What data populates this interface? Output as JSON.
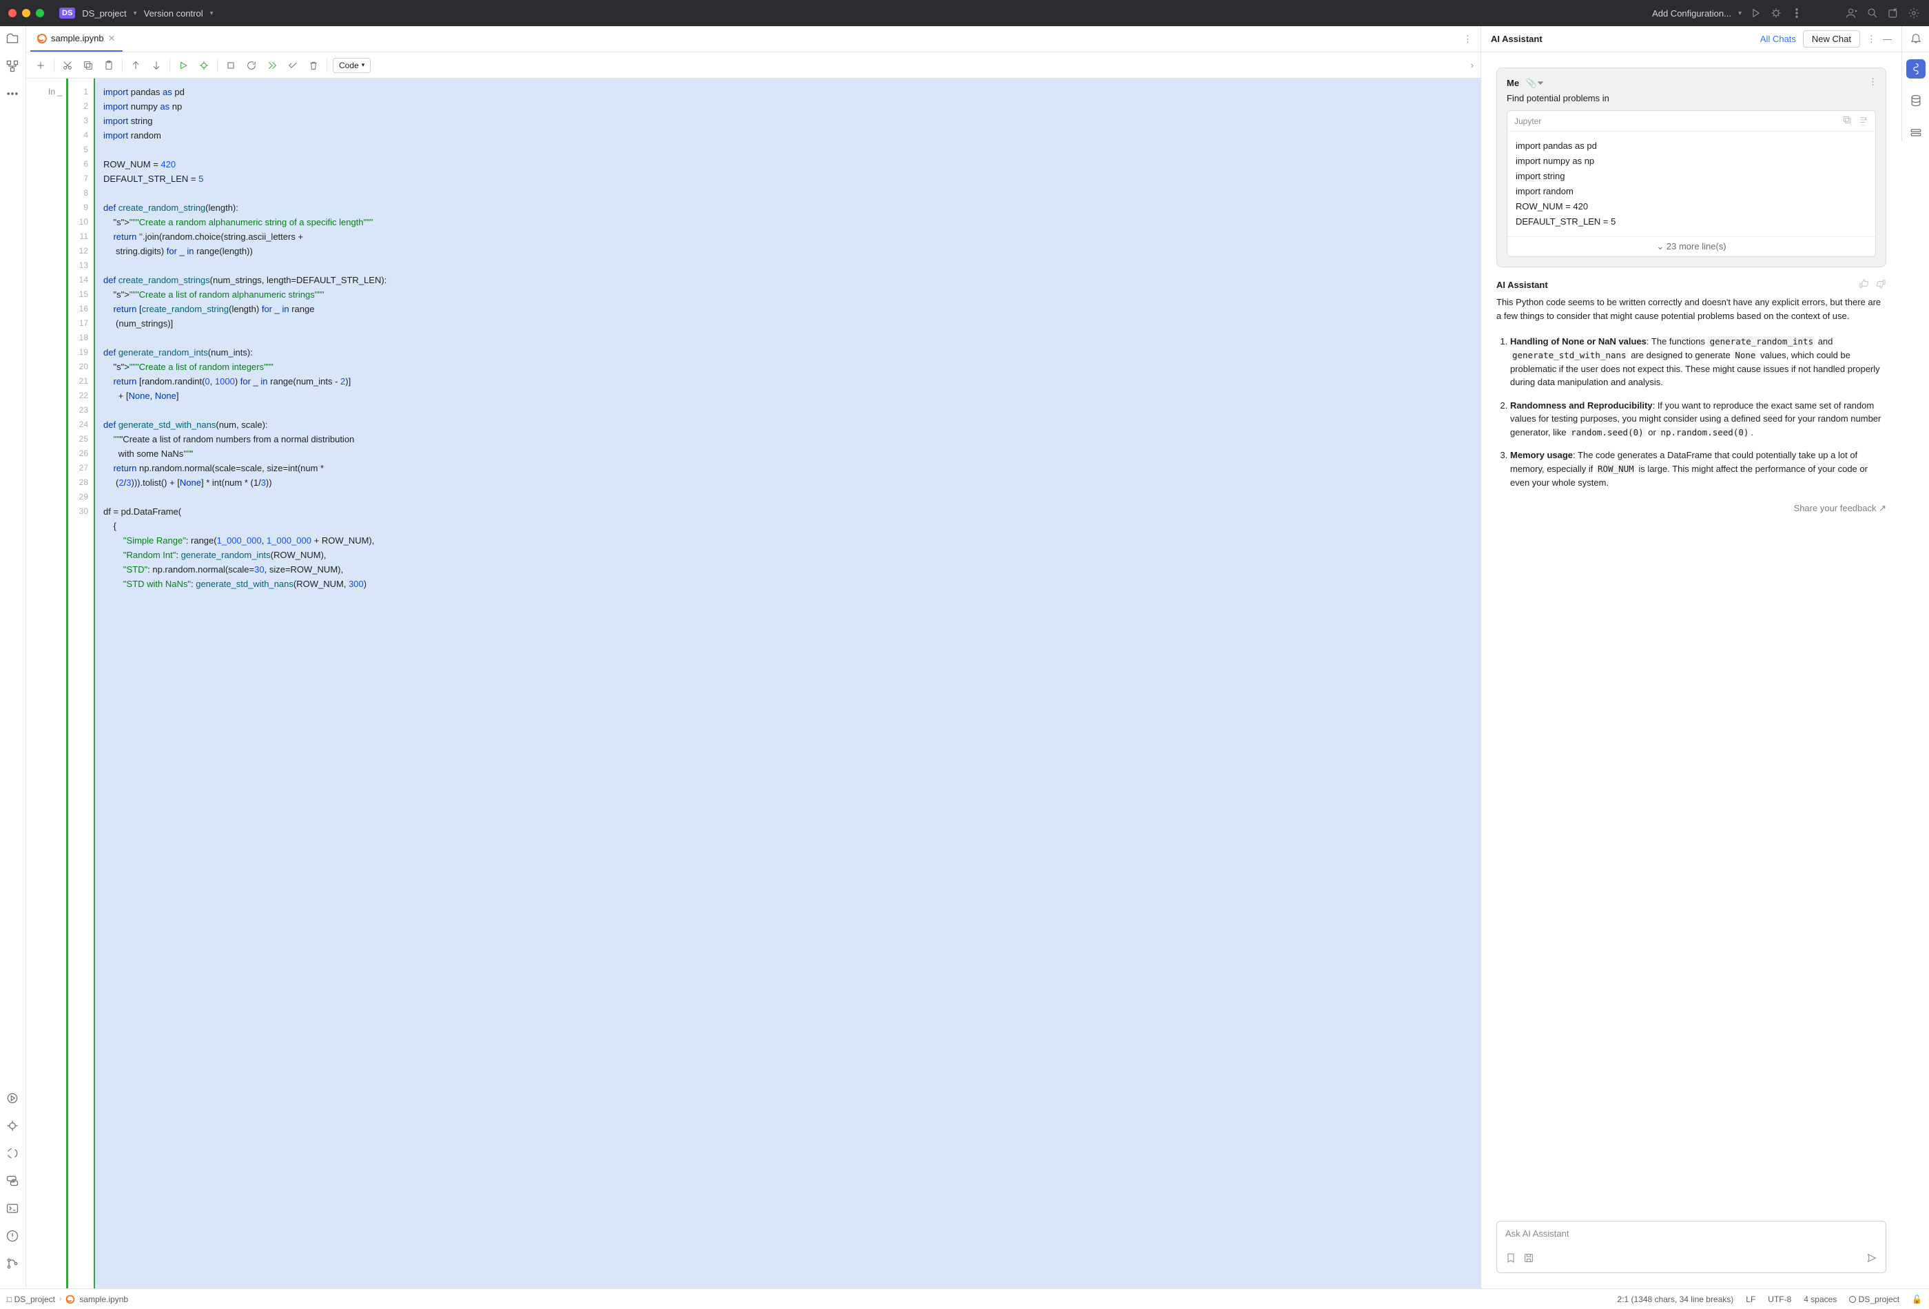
{
  "titlebar": {
    "project_badge": "DS",
    "project_name": "DS_project",
    "vcs": "Version control",
    "run_config": "Add Configuration..."
  },
  "tab": {
    "filename": "sample.ipynb"
  },
  "toolbar": {
    "cell_type": "Code"
  },
  "editor": {
    "in_label": "In _",
    "line_count": 30,
    "code": "import pandas as pd\nimport numpy as np\nimport string\nimport random\n\nROW_NUM = 420\nDEFAULT_STR_LEN = 5\n\ndef create_random_string(length):\n    \"\"\"Create a random alphanumeric string of a specific length\"\"\"\n    return ''.join(random.choice(string.ascii_letters +\n     string.digits) for _ in range(length))\n\ndef create_random_strings(num_strings, length=DEFAULT_STR_LEN):\n    \"\"\"Create a list of random alphanumeric strings\"\"\"\n    return [create_random_string(length) for _ in range\n     (num_strings)]\n\ndef generate_random_ints(num_ints):\n    \"\"\"Create a list of random integers\"\"\"\n    return [random.randint(0, 1000) for _ in range(num_ints - 2)]\n      + [None, None]\n\ndef generate_std_with_nans(num, scale):\n    \"\"\"Create a list of random numbers from a normal distribution\n      with some NaNs\"\"\"\n    return np.random.normal(scale=scale, size=int(num *\n     (2/3))).tolist() + [None] * int(num * (1/3))\n\ndf = pd.DataFrame(\n    {\n        \"Simple Range\": range(1_000_000, 1_000_000 + ROW_NUM),\n        \"Random Int\": generate_random_ints(ROW_NUM),\n        \"STD\": np.random.normal(scale=30, size=ROW_NUM),\n        \"STD with NaNs\": generate_std_with_nans(ROW_NUM, 300)"
  },
  "ai": {
    "header_title": "AI Assistant",
    "all_chats": "All Chats",
    "new_chat": "New Chat",
    "me_label": "Me",
    "me_msg": "Find potential problems in",
    "code_lang": "Jupyter",
    "code_snippet": "import pandas as pd\nimport numpy as np\nimport string\nimport random\nROW_NUM = 420\nDEFAULT_STR_LEN = 5",
    "more_lines": "23 more line(s)",
    "assistant_label": "AI Assistant",
    "assistant_intro": "This Python code seems to be written correctly and doesn't have any explicit errors, but there are a few things to consider that might cause potential problems based on the context of use.",
    "point1_title": "Handling of None or NaN values",
    "point1_a": ": The functions ",
    "point1_code1": "generate_random_ints",
    "point1_b": " and ",
    "point1_code2": "generate_std_with_nans",
    "point1_c": " are designed to generate ",
    "point1_code3": "None",
    "point1_d": " values, which could be problematic if the user does not expect this. These might cause issues if not handled properly during data manipulation and analysis.",
    "point2_title": "Randomness and Reproducibility",
    "point2_a": ": If you want to reproduce the exact same set of random values for testing purposes, you might consider using a defined seed for your random number generator, like ",
    "point2_code1": "random.seed(0)",
    "point2_b": " or ",
    "point2_code2": "np.random.seed(0)",
    "point2_c": ".",
    "point3_title": "Memory usage",
    "point3_a": ": The code generates a DataFrame that could potentially take up a lot of memory, especially if ",
    "point3_code1": "ROW_NUM",
    "point3_b": " is large. This might affect the performance of your code or even your whole system.",
    "feedback": "Share your feedback ↗",
    "input_placeholder": "Ask AI Assistant"
  },
  "status": {
    "project": "DS_project",
    "file": "sample.ipynb",
    "pos": "2:1 (1348 chars, 34 line breaks)",
    "line_sep": "LF",
    "encoding": "UTF-8",
    "indent": "4 spaces",
    "branch": "DS_project",
    "lock": "🔓"
  }
}
